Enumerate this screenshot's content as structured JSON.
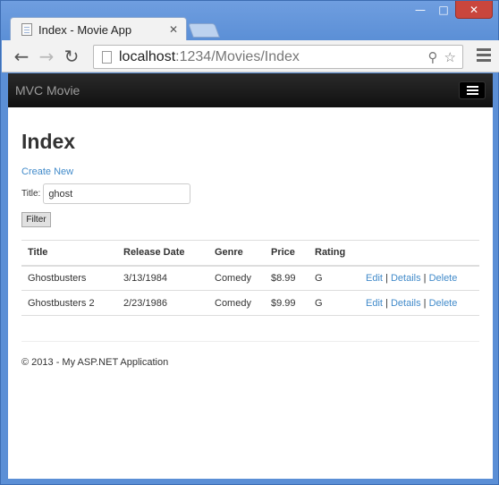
{
  "window": {
    "minimize_glyph": "—",
    "maximize_glyph": "□",
    "close_glyph": "✕"
  },
  "tab": {
    "title": "Index - Movie App",
    "close_glyph": "✕"
  },
  "toolbar": {
    "back_glyph": "←",
    "forward_glyph": "→",
    "reload_glyph": "↻",
    "url_host": "localhost",
    "url_path": ":1234/Movies/Index",
    "search_glyph": "⚲",
    "star_glyph": "☆",
    "icons": [
      "back-icon",
      "forward-icon",
      "reload-icon",
      "page-icon",
      "search-icon",
      "star-icon",
      "menu-icon"
    ]
  },
  "navbar": {
    "brand": "MVC Movie"
  },
  "page": {
    "title": "Index",
    "create_link": "Create New",
    "filter": {
      "label": "Title:",
      "value": "ghost",
      "button": "Filter"
    }
  },
  "table": {
    "headers": [
      "Title",
      "Release Date",
      "Genre",
      "Price",
      "Rating",
      ""
    ],
    "rows": [
      {
        "title": "Ghostbusters",
        "release_date": "3/13/1984",
        "genre": "Comedy",
        "price": "$8.99",
        "rating": "G"
      },
      {
        "title": "Ghostbusters 2",
        "release_date": "2/23/1986",
        "genre": "Comedy",
        "price": "$9.99",
        "rating": "G"
      }
    ],
    "actions": {
      "edit": "Edit",
      "details": "Details",
      "delete": "Delete",
      "separator": "|"
    }
  },
  "footer": {
    "text": "© 2013 - My ASP.NET Application"
  },
  "colors": {
    "window_frame": "#5b8fd6",
    "close_button": "#c9463d",
    "navbar": "#111111",
    "link": "#428bca"
  }
}
